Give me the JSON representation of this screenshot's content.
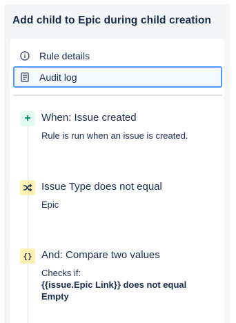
{
  "panel": {
    "title": "Add child to Epic during child creation"
  },
  "menu": {
    "items": [
      {
        "label": "Rule details",
        "icon": "info-icon",
        "selected": false
      },
      {
        "label": "Audit log",
        "icon": "audit-log-icon",
        "selected": true
      }
    ]
  },
  "steps": [
    {
      "kind": "trigger",
      "icon": "plus-icon",
      "title": "When: Issue created",
      "desc": "Rule is run when an issue is created."
    },
    {
      "kind": "condition",
      "icon": "shuffle-icon",
      "title": "Issue Type does not equal",
      "desc": "Epic"
    },
    {
      "kind": "condition",
      "icon": "braces-icon",
      "title": "And: Compare two values",
      "desc_prefix": "Checks if:",
      "desc_bold_1": "{{issue.Epic Link}} does not equal",
      "desc_bold_2": "Empty"
    }
  ],
  "colors": {
    "trigger_bg": "#e3fcef",
    "trigger_fg": "#00875a",
    "condition_bg": "#fff0b3",
    "selected_border": "#4c9aff"
  }
}
